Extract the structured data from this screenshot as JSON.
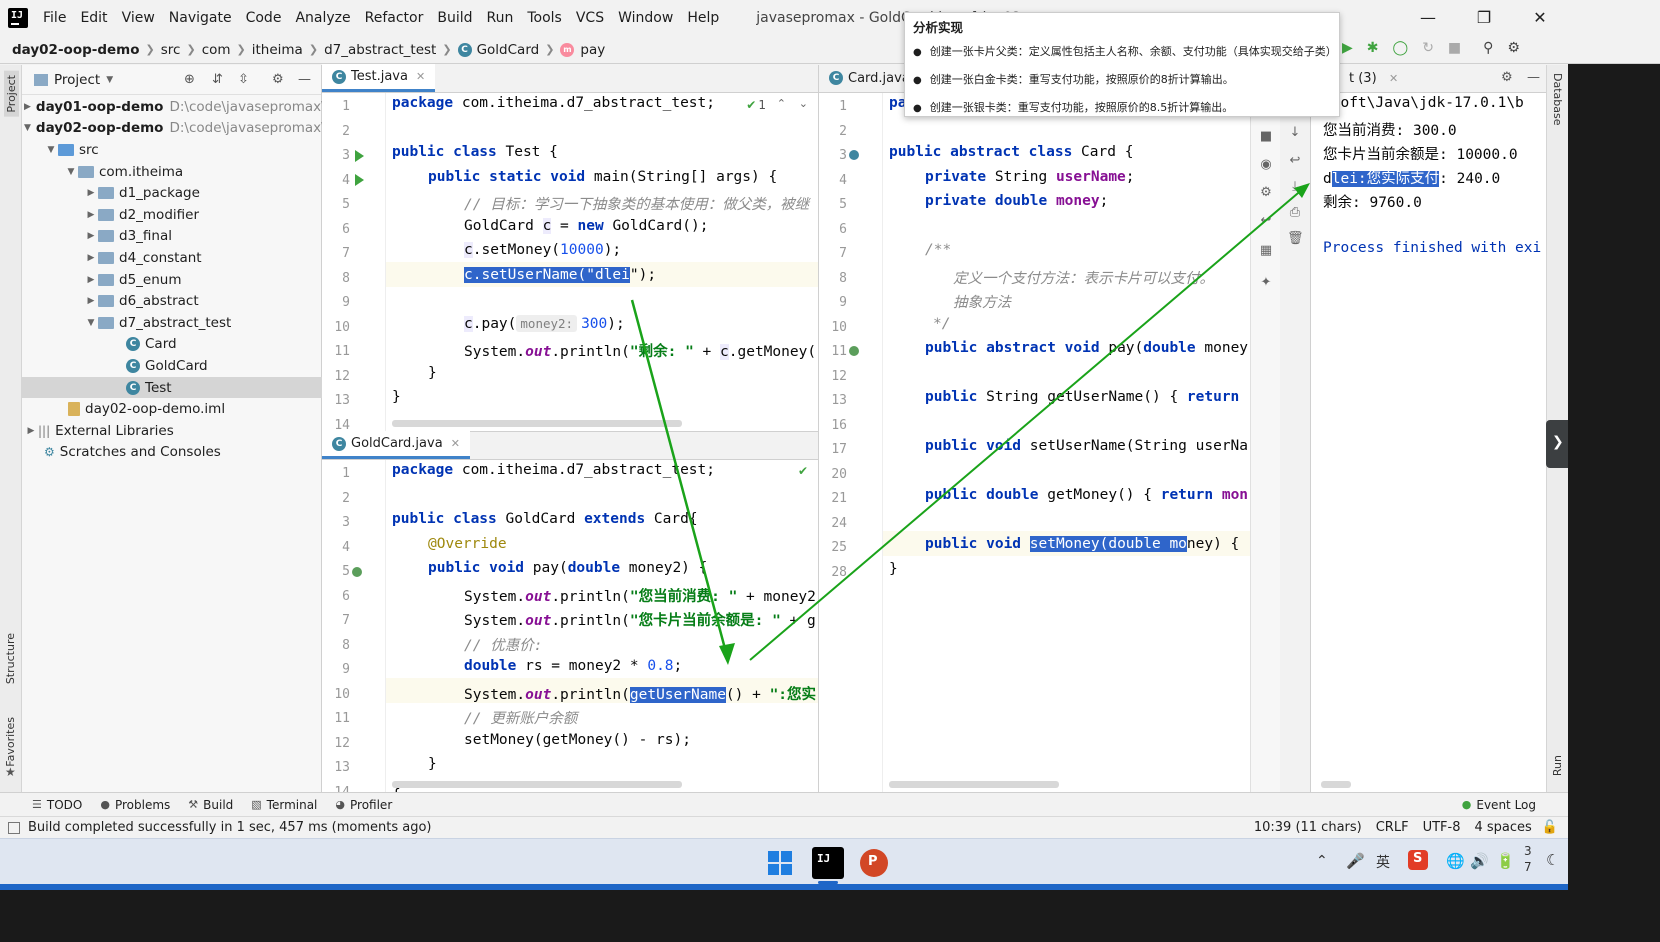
{
  "menubar": {
    "items": [
      "File",
      "Edit",
      "View",
      "Navigate",
      "Code",
      "Analyze",
      "Refactor",
      "Build",
      "Run",
      "Tools",
      "VCS",
      "Window",
      "Help"
    ],
    "window_title": "javasepromax - GoldCard.java [day02-oop"
  },
  "breadcrumb": {
    "items": [
      "day02-oop-demo",
      "src",
      "com",
      "itheima",
      "d7_abstract_test",
      "GoldCard",
      "pay"
    ]
  },
  "left_strip": {
    "project": "Project",
    "structure": "Structure",
    "favorites": "Favorites"
  },
  "right_strip": {
    "database": "Database",
    "run": "Run"
  },
  "project_panel": {
    "title": "Project",
    "tree": [
      {
        "label": "day01-oop-demo",
        "path": "D:\\code\\javasepromax\\"
      },
      {
        "label": "day02-oop-demo",
        "path": "D:\\code\\javasepromax\\"
      },
      {
        "label": "src"
      },
      {
        "label": "com.itheima"
      },
      {
        "label": "d1_package"
      },
      {
        "label": "d2_modifier"
      },
      {
        "label": "d3_final"
      },
      {
        "label": "d4_constant"
      },
      {
        "label": "d5_enum"
      },
      {
        "label": "d6_abstract"
      },
      {
        "label": "d7_abstract_test"
      },
      {
        "label": "Card"
      },
      {
        "label": "GoldCard"
      },
      {
        "label": "Test"
      },
      {
        "label": "day02-oop-demo.iml"
      },
      {
        "label": "External Libraries"
      },
      {
        "label": "Scratches and Consoles"
      }
    ]
  },
  "editor_test": {
    "tab": "Test.java",
    "inspection": "1",
    "line_numbers": [
      "1",
      "2",
      "3",
      "4",
      "5",
      "6",
      "7",
      "8",
      "9",
      "10",
      "11",
      "12",
      "13",
      "14"
    ],
    "lines": {
      "l1_kw": "package",
      "l1_rest": " com.itheima.d7_abstract_test;",
      "l3_kw": "public class",
      "l3_rest": " Test {",
      "l4_kw": "public static void",
      "l4_rest": " main(String[] args) {",
      "l5": "// 目标：学习一下抽象类的基本使用：做父类，被继",
      "l6_a": "GoldCard ",
      "l6_b": "c",
      "l6_c": " = ",
      "l6_kw": "new",
      "l6_d": " GoldCard();",
      "l7_a": "c",
      "l7_b": ".setMoney(",
      "l7_num": "10000",
      "l7_c": ");",
      "l8_sel": "c.setUserName(\"dlei",
      "l8_end": "\");",
      "l10_a": "c",
      "l10_b": ".pay(",
      "l10_hint": "money2:",
      "l10_num": "300",
      "l10_c": ");",
      "l11_a": "System.",
      "l11_out": "out",
      "l11_b": ".println(",
      "l11_str": "\"剩余: \"",
      "l11_c": " + ",
      "l11_d": "c",
      "l11_e": ".getMoney(",
      "l12": "}",
      "l13": "}"
    }
  },
  "editor_gold": {
    "tab": "GoldCard.java",
    "line_numbers": [
      "1",
      "2",
      "3",
      "4",
      "5",
      "6",
      "7",
      "8",
      "9",
      "10",
      "11",
      "12",
      "13",
      "14"
    ],
    "lines": {
      "l1_kw": "package",
      "l1_rest": " com.itheima.d7_abstract_test;",
      "l3_kw": "public class",
      "l3_a": " GoldCard ",
      "l3_kw2": "extends",
      "l3_b": " Card{",
      "l4": "@Override",
      "l5_kw": "public void",
      "l5_rest": " pay(",
      "l5_kw2": "double",
      "l5_rest2": " money2) {",
      "l6_a": "System.",
      "l6_out": "out",
      "l6_b": ".println(",
      "l6_str": "\"您当前消费: \"",
      "l6_c": " + money2",
      "l7_a": "System.",
      "l7_out": "out",
      "l7_b": ".println(",
      "l7_str": "\"您卡片当前余额是: \"",
      "l7_c": " + g",
      "l8": "// 优惠价:",
      "l9_kw": "double",
      "l9_a": " rs = money2 * ",
      "l9_num": "0.8",
      "l9_b": ";",
      "l10_a": "System.",
      "l10_out": "out",
      "l10_b": ".println(",
      "l10_sel": "getUserName",
      "l10_c": "() + ",
      "l10_str": "\":您实",
      "l11": "// 更新账户余额",
      "l12": "setMoney(getMoney() - rs);",
      "l13": "}",
      "l14": "}"
    }
  },
  "editor_card": {
    "tab": "Card.java",
    "line_numbers": [
      "1",
      "2",
      "3",
      "4",
      "5",
      "6",
      "7",
      "8",
      "9",
      "10",
      "11",
      "12",
      "13",
      "16",
      "17",
      "20",
      "21",
      "24",
      "25",
      "28"
    ],
    "lines": {
      "l1": "pa",
      "l3_kw": "public abstract class",
      "l3_rest": " Card {",
      "l4_kw": "private",
      "l4_a": " String ",
      "l4_fld": "userName",
      "l4_b": ";",
      "l5_kw": "private double",
      "l5_a": " ",
      "l5_fld": "money",
      "l5_b": ";",
      "l7": "/**",
      "l8": "定义一个支付方法：表示卡片可以支付。",
      "l9": "抽象方法",
      "l10": "*/",
      "l11_kw": "public abstract void",
      "l11_rest": " pay(",
      "l11_kw2": "double",
      "l11_rest2": " money",
      "l13_kw": "public",
      "l13_a": " String getUserName() { ",
      "l13_kw2": "return",
      "l17_kw": "public void",
      "l17_rest": " setUserName(String userNa",
      "l21_kw": "public double",
      "l21_rest": " getMoney() { ",
      "l21_kw2": "return",
      "l21_fld": " mon",
      "l25_kw": "public void",
      "l25_a": " ",
      "l25_sel": "setMoney(double mo",
      "l25_b": "ney) {",
      "l28": "}"
    }
  },
  "console": {
    "tab": "t (3)",
    "lines": [
      "\\soft\\Java\\jdk-17.0.1\\b",
      "您当前消费: 300.0",
      "您卡片当前余额是: 10000.0",
      "dlei:您实际支付: 240.0",
      "剩余: 9760.0",
      "Process finished with exi"
    ],
    "line4_sel": "lei:您实际支付",
    "line4_pre": "d",
    "line4_post": ": 240.0"
  },
  "popup": {
    "title": "分析实现",
    "items": [
      "创建一张卡片父类：定义属性包括主人名称、余额、支付功能（具体实现交给子类）",
      "创建一张白金卡类：重写支付功能，按照原价的8折计算输出。",
      "创建一张银卡类：重写支付功能，按照原价的8.5折计算输出。"
    ]
  },
  "bottom_tools": [
    "TODO",
    "Problems",
    "Build",
    "Terminal",
    "Profiler",
    "Event Log"
  ],
  "statusbar": {
    "message": "Build completed successfully in 1 sec, 457 ms (moments ago)",
    "position": "10:39 (11 chars)",
    "line_sep": "CRLF",
    "encoding": "UTF-8",
    "indent": "4 spaces"
  },
  "taskbar": {
    "clock_1": "3",
    "clock_2": "7",
    "ime": "英"
  },
  "colors": {
    "accent": "#2f65ca",
    "keyword": "#0033b3",
    "string": "#067d17",
    "arrow": "#1aa31a"
  }
}
